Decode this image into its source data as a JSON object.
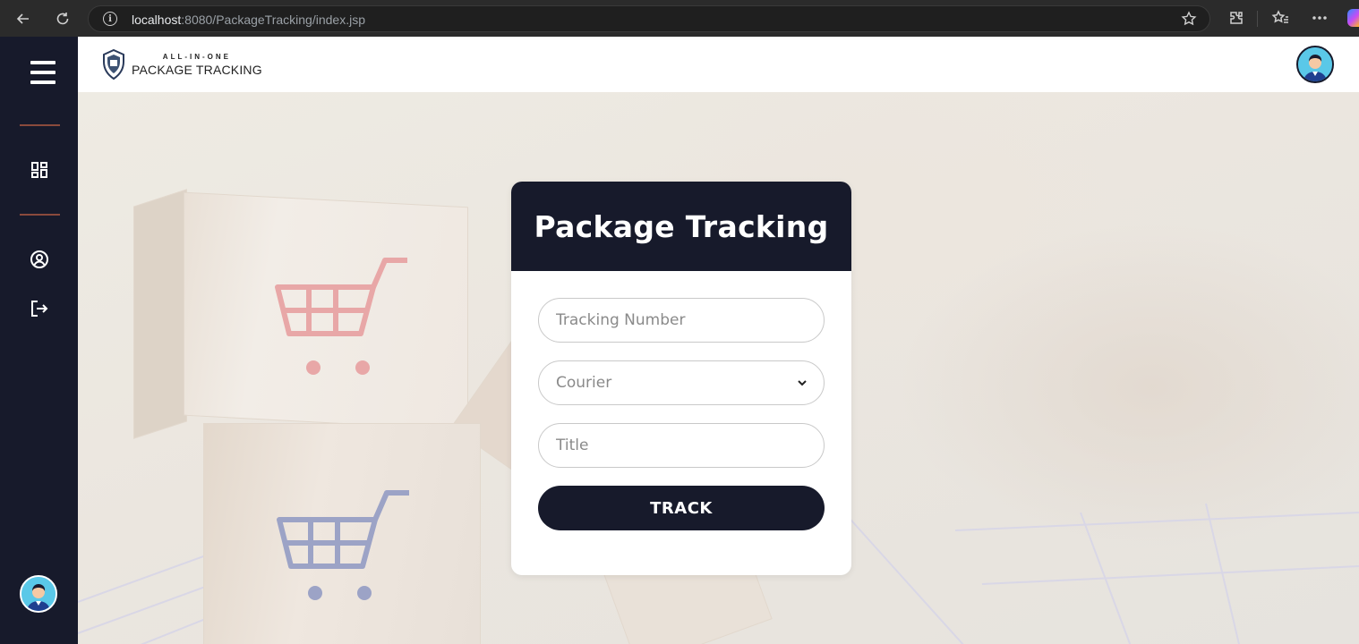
{
  "browser": {
    "url_host": "localhost",
    "url_rest": ":8080/PackageTracking/index.jsp"
  },
  "sidebar": {
    "items": [
      {
        "icon": "dashboard-icon"
      },
      {
        "icon": "account-circle-icon"
      },
      {
        "icon": "logout-icon"
      }
    ]
  },
  "header": {
    "logo_small": "ALL-IN-ONE",
    "logo_big": "PACKAGE TRACKING"
  },
  "form": {
    "title": "Package Tracking",
    "tracking_placeholder": "Tracking Number",
    "courier_placeholder": "Courier",
    "title_placeholder": "Title",
    "track_label": "TRACK"
  },
  "colors": {
    "sidebar_bg": "#171a2b",
    "accent_divider": "#8a4a3c",
    "button_bg": "#171a2b"
  }
}
